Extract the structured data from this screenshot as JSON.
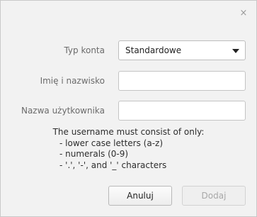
{
  "dialog": {
    "close_glyph": "×"
  },
  "form": {
    "account_type": {
      "label": "Typ konta",
      "selected": "Standardowe"
    },
    "full_name": {
      "label": "Imię i nazwisko",
      "value": ""
    },
    "username": {
      "label": "Nazwa użytkownika",
      "value": ""
    }
  },
  "hint": {
    "title": "The username must consist of only:",
    "items": [
      "- lower case letters (a-z)",
      "- numerals (0-9)",
      "- '.', '-', and '_' characters"
    ]
  },
  "buttons": {
    "cancel_label": "Anuluj",
    "add_label": "Dodaj"
  },
  "colors": {
    "dialog_background": "#f2f2f2",
    "disabled_text": "#a8a8a8"
  }
}
